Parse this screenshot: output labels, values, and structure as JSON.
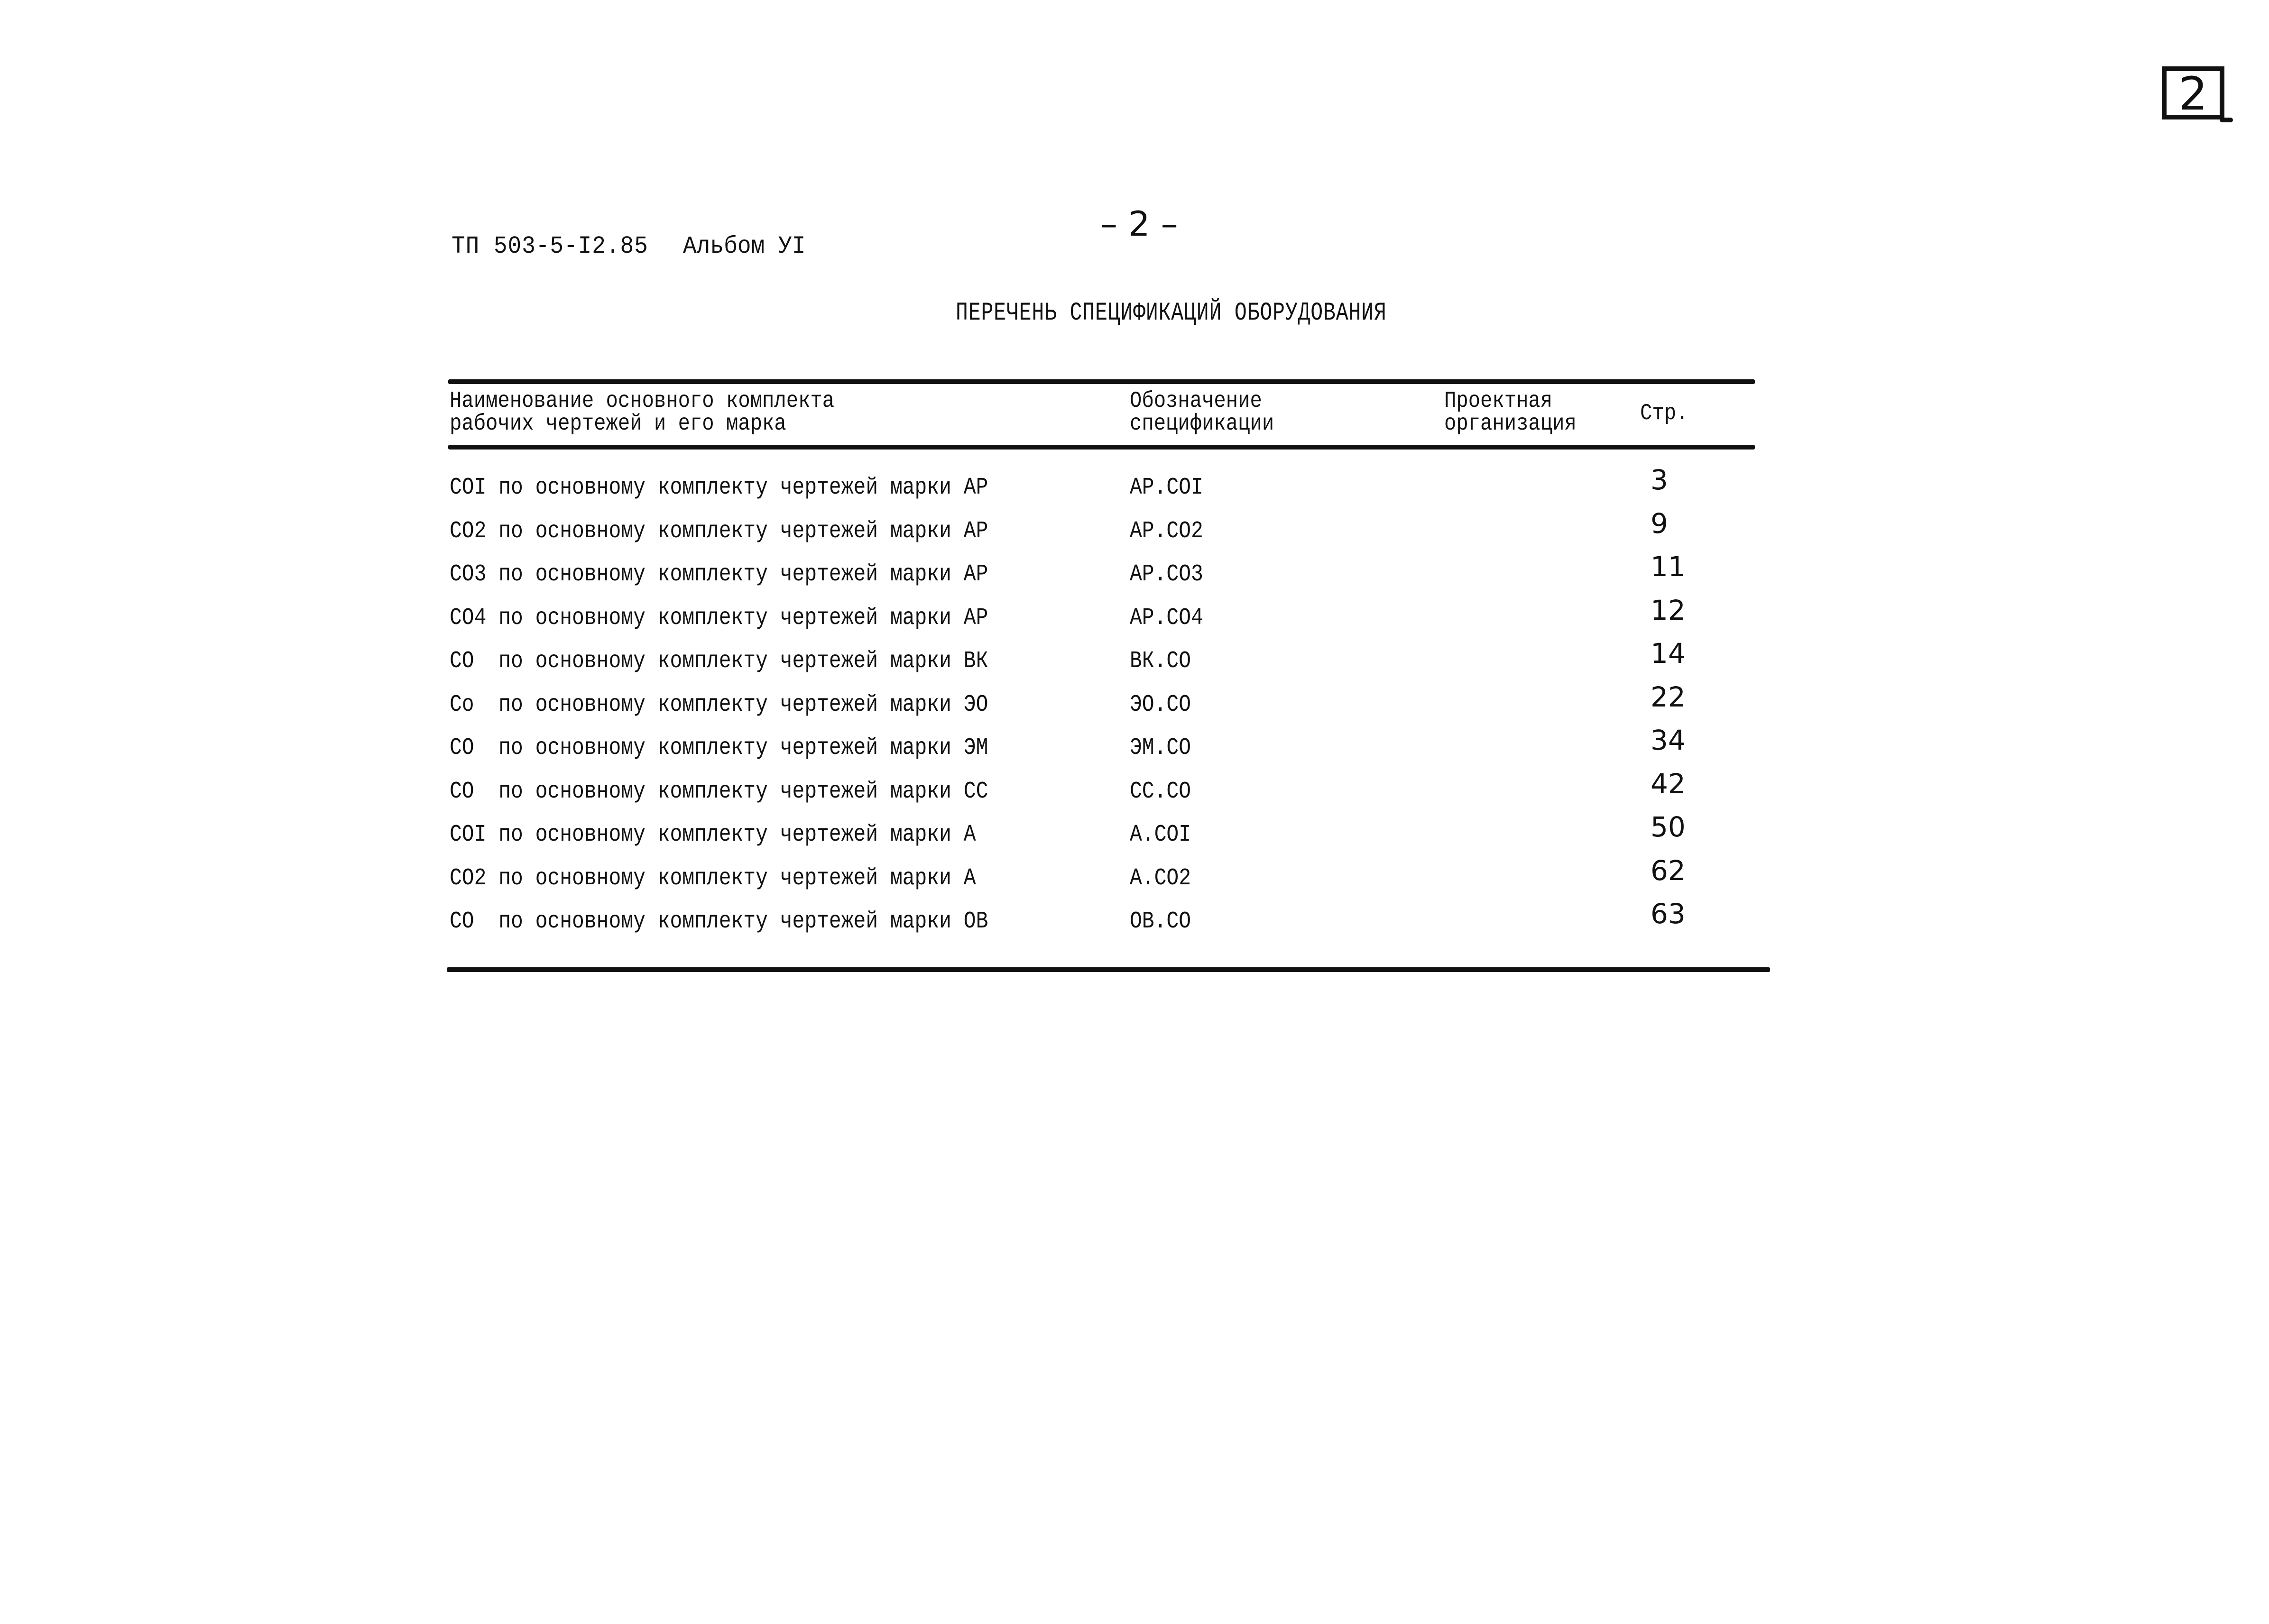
{
  "corner_page_number": "2",
  "header": {
    "document_code": "ТП 503-5-I2.85",
    "album": "Альбом УI",
    "page_number": "– 2 –"
  },
  "title": "ПЕРЕЧЕНЬ СПЕЦИФИКАЦИЙ ОБОРУДОВАНИЯ",
  "table": {
    "columns": {
      "name": [
        "Наименование основного комплекта",
        "рабочих чертежей и его марка"
      ],
      "code": [
        "Обозначение",
        "спецификации"
      ],
      "org": [
        "Проектная",
        "организация"
      ],
      "page": "Стр."
    },
    "rows": [
      {
        "name": "COI по основному комплекту чертежей марки АР",
        "code": "АР.COI",
        "org": "",
        "page": "3"
      },
      {
        "name": "CO2 по основному комплекту чертежей марки АР",
        "code": "АР.CO2",
        "org": "",
        "page": "9"
      },
      {
        "name": "CO3 по основному комплекту чертежей марки АР",
        "code": "АР.CO3",
        "org": "",
        "page": "11"
      },
      {
        "name": "CO4 по основному комплекту чертежей марки АР",
        "code": "АР.CO4",
        "org": "",
        "page": "12"
      },
      {
        "name": "CO  по основному комплекту чертежей марки ВК",
        "code": "ВК.CO",
        "org": "",
        "page": "14"
      },
      {
        "name": "Co  по основному комплекту чертежей марки ЭО",
        "code": "ЭО.CO",
        "org": "",
        "page": "22"
      },
      {
        "name": "CO  по основному комплекту чертежей марки ЭМ",
        "code": "ЭМ.CO",
        "org": "",
        "page": "34"
      },
      {
        "name": "CO  по основному комплекту чертежей марки СС",
        "code": "СС.CO",
        "org": "",
        "page": "42"
      },
      {
        "name": "COI по основному комплекту чертежей марки А",
        "code": "А.COI",
        "org": "",
        "page": "50"
      },
      {
        "name": "CO2 по основному комплекту чертежей марки А",
        "code": "А.CO2",
        "org": "",
        "page": "62"
      },
      {
        "name": "CO  по основному комплекту чертежей марки ОВ",
        "code": "ОВ.CO",
        "org": "",
        "page": "63"
      }
    ]
  }
}
